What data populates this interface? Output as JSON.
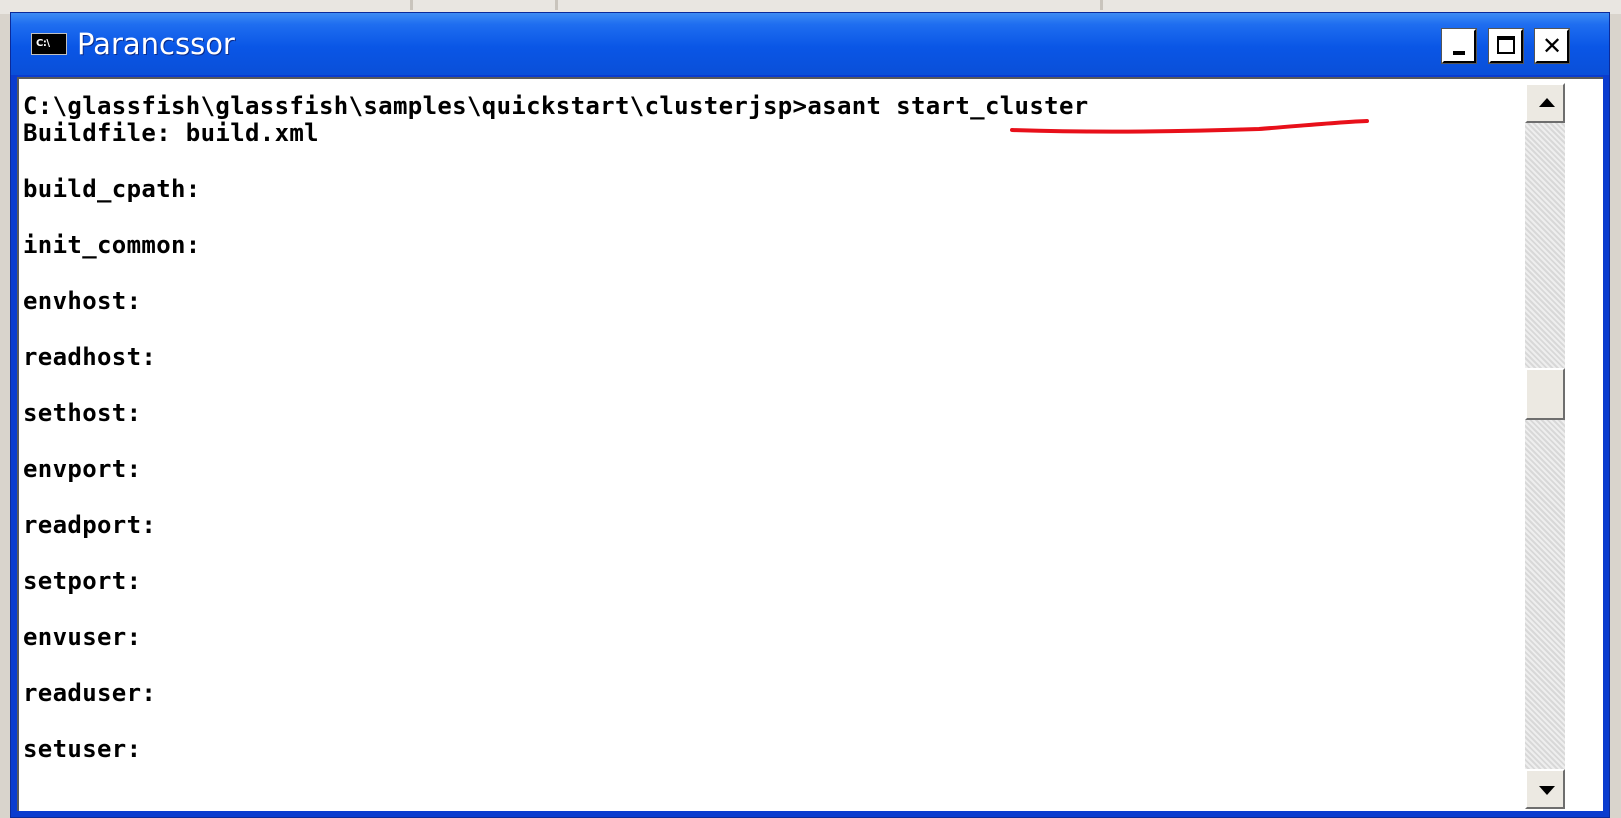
{
  "window": {
    "title": "Parancssor",
    "icon_label": "C:\\",
    "icon": "console-icon",
    "controls": [
      "minimize-icon",
      "maximize-icon",
      "close-icon"
    ],
    "close_label": "✕"
  },
  "console": {
    "lines": [
      "C:\\glassfish\\glassfish\\samples\\quickstart\\clusterjsp>asant start_cluster",
      "Buildfile: build.xml",
      "",
      "build_cpath:",
      "",
      "init_common:",
      "",
      "envhost:",
      "",
      "readhost:",
      "",
      "sethost:",
      "",
      "envport:",
      "",
      "readport:",
      "",
      "setport:",
      "",
      "envuser:",
      "",
      "readuser:",
      "",
      "setuser:"
    ],
    "annotation_color": "#e8101a",
    "text_color": "#000000",
    "background": "#ffffff"
  },
  "scrollbar": {
    "icons": [
      "scroll-up-icon",
      "scroll-down-icon"
    ]
  },
  "theme": {
    "titlebar": "#0a56e6",
    "desktop": "#d9d4cc"
  }
}
